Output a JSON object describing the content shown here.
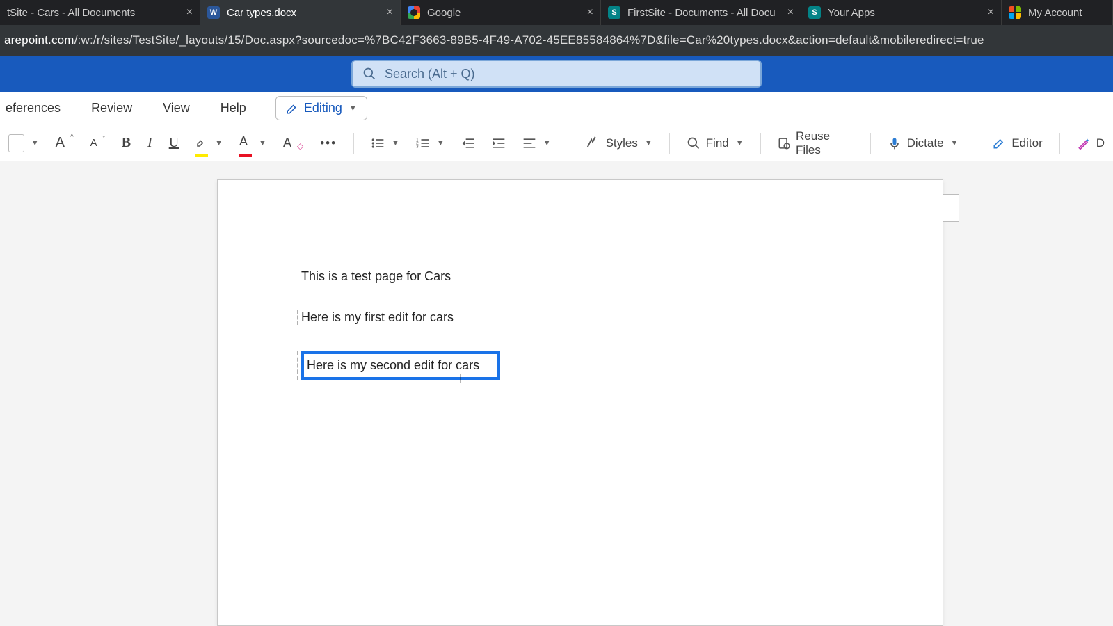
{
  "tabs": [
    {
      "label": "tSite - Cars - All Documents",
      "favicon": "sp"
    },
    {
      "label": "Car types.docx",
      "favicon": "word",
      "active": true
    },
    {
      "label": "Google",
      "favicon": "google"
    },
    {
      "label": "FirstSite - Documents - All Docu",
      "favicon": "sp"
    },
    {
      "label": "Your Apps",
      "favicon": "sp"
    },
    {
      "label": "My Account",
      "favicon": "ms",
      "last": true
    }
  ],
  "url": {
    "host": "arepoint.com",
    "path": "/:w:/r/sites/TestSite/_layouts/15/Doc.aspx?sourcedoc=%7BC42F3663-89B5-4F49-A702-45EE85584864%7D&file=Car%20types.docx&action=default&mobileredirect=true"
  },
  "search_placeholder": "Search (Alt + Q)",
  "ribbon": {
    "tabs": [
      "eferences",
      "Review",
      "View",
      "Help"
    ],
    "editing_label": "Editing"
  },
  "toolbar": {
    "styles": "Styles",
    "find": "Find",
    "reuse": "Reuse Files",
    "dictate": "Dictate",
    "editor": "Editor"
  },
  "document": {
    "p1": "This is a test page for Cars",
    "p2": "Here is my first edit for cars",
    "p3": "Here is my second edit for cars"
  }
}
